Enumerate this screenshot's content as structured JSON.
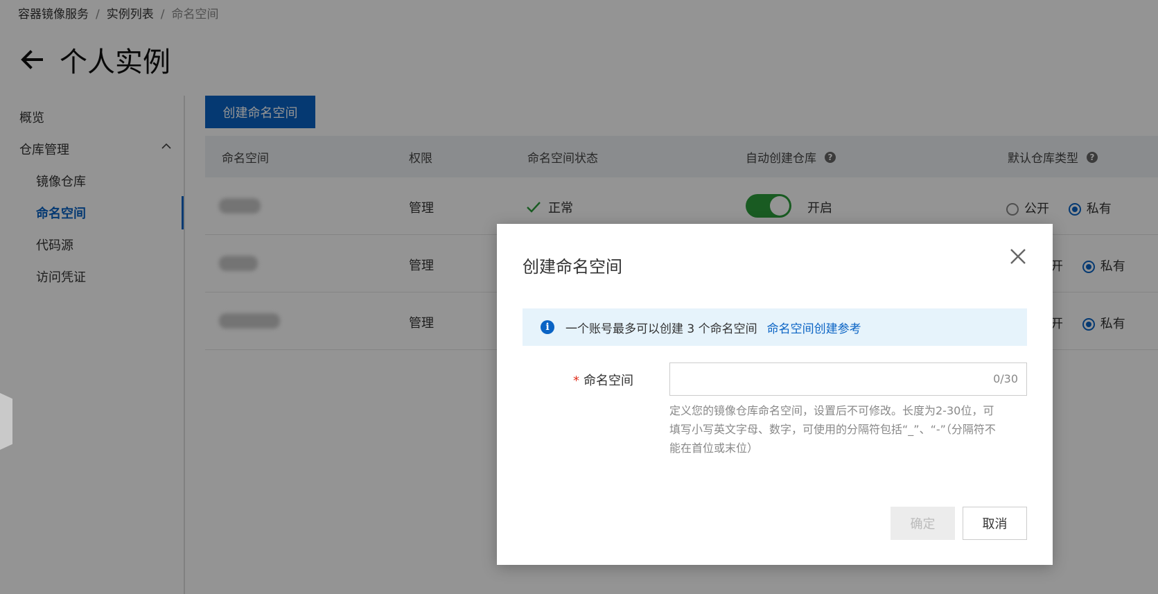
{
  "breadcrumb": {
    "item1": "容器镜像服务",
    "item2": "实例列表",
    "item3": "命名空间",
    "sep": "/"
  },
  "page_title": "个人实例",
  "sidebar": {
    "overview": "概览",
    "repo_management": "仓库管理",
    "image_repo": "镜像仓库",
    "namespace": "命名空间",
    "code_source": "代码源",
    "access_credential": "访问凭证"
  },
  "toolbar": {
    "create_label": "创建命名空间"
  },
  "table": {
    "columns": {
      "namespace": "命名空间",
      "permission": "权限",
      "status": "命名空间状态",
      "auto_create": "自动创建仓库",
      "default_type": "默认仓库类型"
    },
    "rows": [
      {
        "permission": "管理",
        "status": "正常",
        "auto_create": "开启",
        "public_label": "公开",
        "private_label": "私有"
      },
      {
        "permission": "管理",
        "public_label_partial": "开",
        "private_label": "私有"
      },
      {
        "permission": "管理",
        "public_label_partial": "开",
        "private_label": "私有"
      }
    ]
  },
  "dialog": {
    "title": "创建命名空间",
    "notice_text": "一个账号最多可以创建 3 个命名空间",
    "notice_link": "命名空间创建参考",
    "field_required_mark": "*",
    "field_label": "命名空间",
    "input_value": "",
    "input_counter": "0/30",
    "help_text": "定义您的镜像仓库命名空间，设置后不可修改。长度为2-30位，可填写小写英文字母、数字，可使用的分隔符包括“_”、“-”（分隔符不能在首位或末位）",
    "ok_label": "确定",
    "cancel_label": "取消"
  },
  "icons": {
    "back": "arrow-left-icon",
    "chevron": "chevron-up-icon",
    "help": "question-circle-icon",
    "check": "check-icon",
    "info": "info-circle-icon",
    "close": "close-icon"
  },
  "colors": {
    "primary": "#0a63c4",
    "success": "#2b9d3b",
    "required": "#e0301e"
  }
}
